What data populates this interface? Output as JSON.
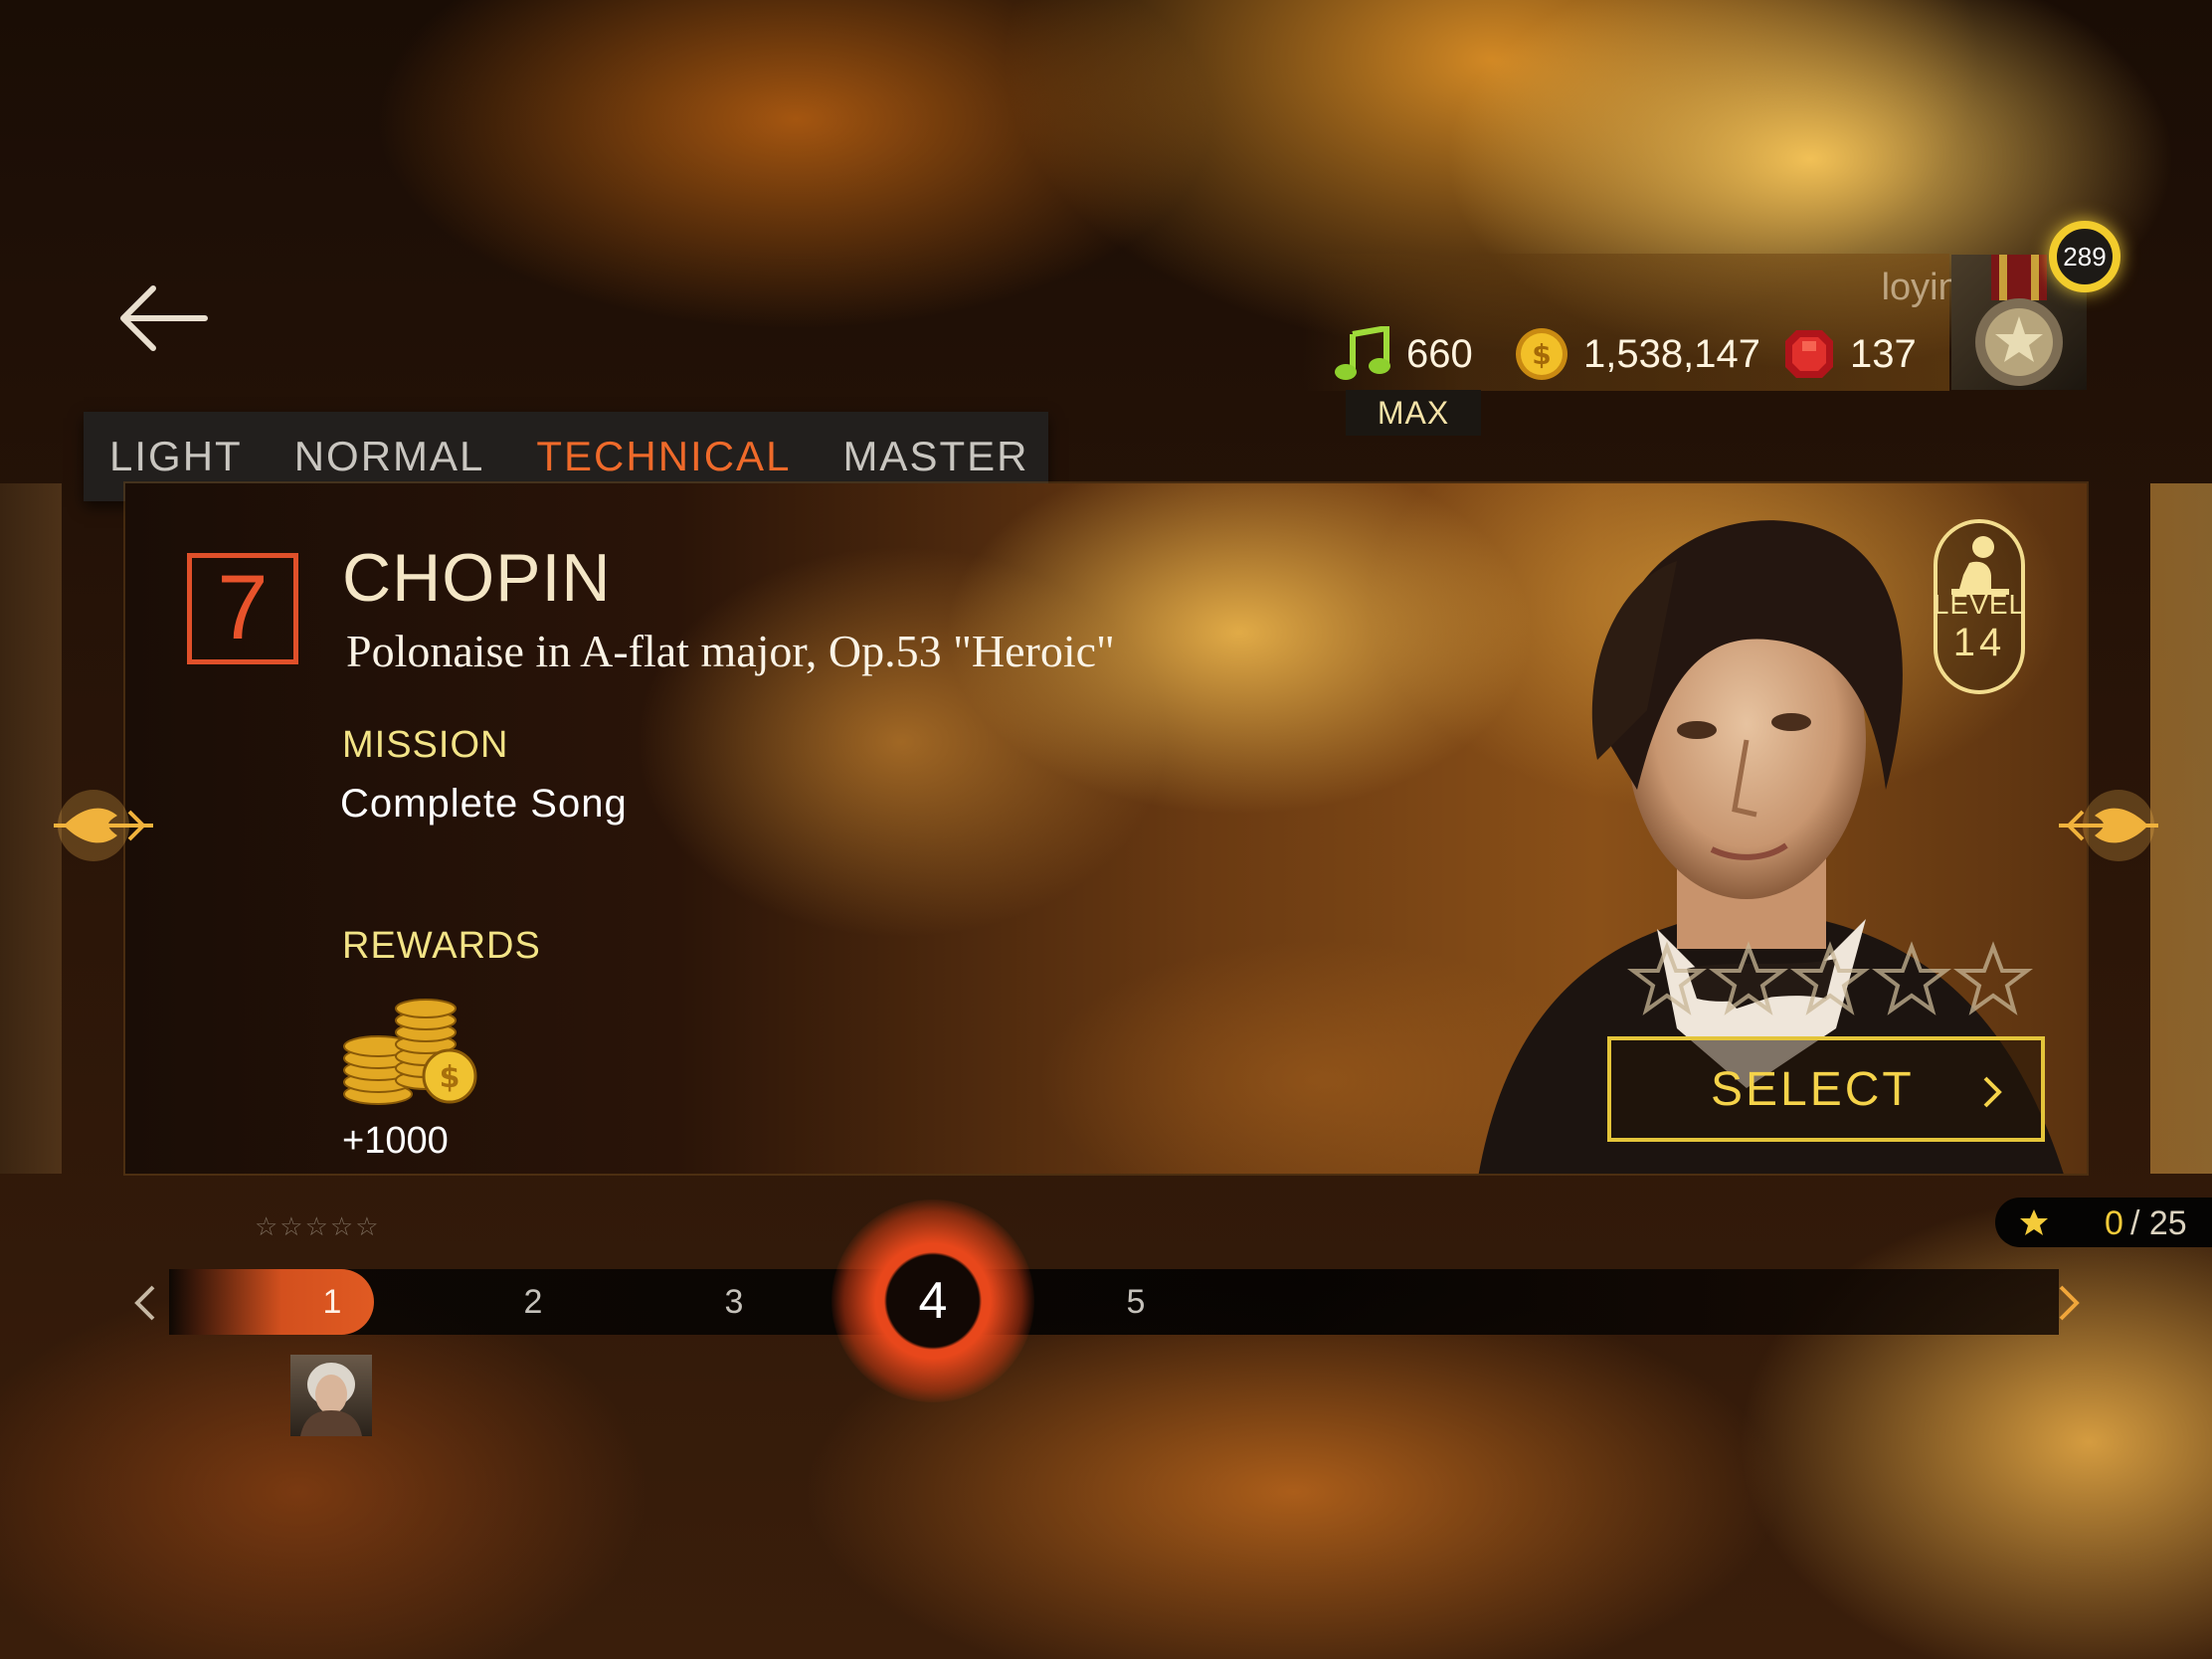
{
  "player": {
    "username": "loyinche",
    "level": "289",
    "notes": "660",
    "notes_status": "MAX",
    "coins": "1,538,147",
    "gems": "137"
  },
  "difficulty_tabs": [
    {
      "label": "LIGHT",
      "active": false
    },
    {
      "label": "NORMAL",
      "active": false
    },
    {
      "label": "TECHNICAL",
      "active": true
    },
    {
      "label": "MASTER",
      "active": false
    }
  ],
  "song": {
    "number": "7",
    "composer": "CHOPIN",
    "title": "Polonaise in A-flat major, Op.53 \"Heroic\"",
    "mission_label": "MISSION",
    "mission": "Complete Song",
    "rewards_label": "REWARDS",
    "reward_amount": "+1000",
    "level_label": "LEVEL",
    "level": "14",
    "stars_earned": 0,
    "stars_total": 5,
    "select_label": "SELECT"
  },
  "progress": {
    "stars_collected": "0",
    "stars_total": "/ 25",
    "stages": [
      "1",
      "2",
      "3",
      "4",
      "5"
    ],
    "current_stage": "4",
    "mini_stars": "☆☆☆☆☆"
  },
  "colors": {
    "accent_orange": "#e8532b",
    "gold": "#f5d34a",
    "mission_yellow": "#f3e487"
  },
  "icons": {
    "back": "arrow-left-icon",
    "notes": "music-note-icon",
    "coins": "coin-icon",
    "gems": "ruby-icon",
    "prev_song": "ornament-left-icon",
    "next_song": "ornament-right-icon",
    "level": "pianist-icon",
    "select": "chevron-right-icon"
  }
}
